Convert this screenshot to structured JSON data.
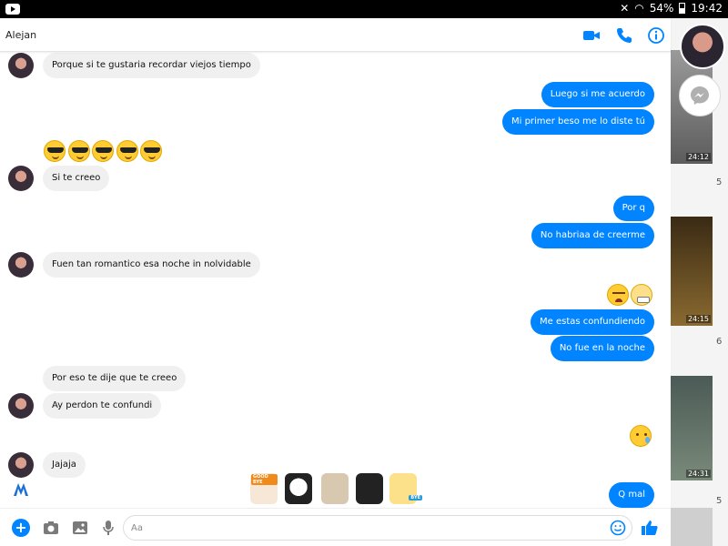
{
  "status_bar": {
    "battery": "54%",
    "time": "19:42"
  },
  "gallery": {
    "durations": [
      "24:12",
      "24:15",
      "24:31"
    ],
    "dots": [
      "5",
      "6",
      "5"
    ]
  },
  "header": {
    "contact_name": "Alejan"
  },
  "messages": {
    "m1": "Porque si te gustaria recordar viejos tiempo",
    "m2": "Luego si me acuerdo",
    "m3": "Mi primer beso me lo diste tú",
    "m4": "Si te creeo",
    "m5": "Por q",
    "m6": "No habriaa de creerme",
    "m7": "Fuen tan romantico esa noche in nolvidable",
    "m8": "Me estas confundiendo",
    "m9": "No fue en la noche",
    "m10": "Por eso te dije que te creeo",
    "m11": "Ay perdon te confundi",
    "m12": "Jajaja",
    "m13": "Q mal"
  },
  "stickers": {
    "good_bye": "GOOD BYE",
    "bye": "BYE"
  },
  "composer": {
    "placeholder": "Aa"
  },
  "colors": {
    "accent": "#0084ff",
    "incoming_bubble": "#f1f0f0"
  },
  "icons": [
    "video-call-icon",
    "phone-icon",
    "info-icon",
    "plus-icon",
    "camera-icon",
    "gallery-icon",
    "mic-icon",
    "emoji-icon",
    "like-icon"
  ]
}
